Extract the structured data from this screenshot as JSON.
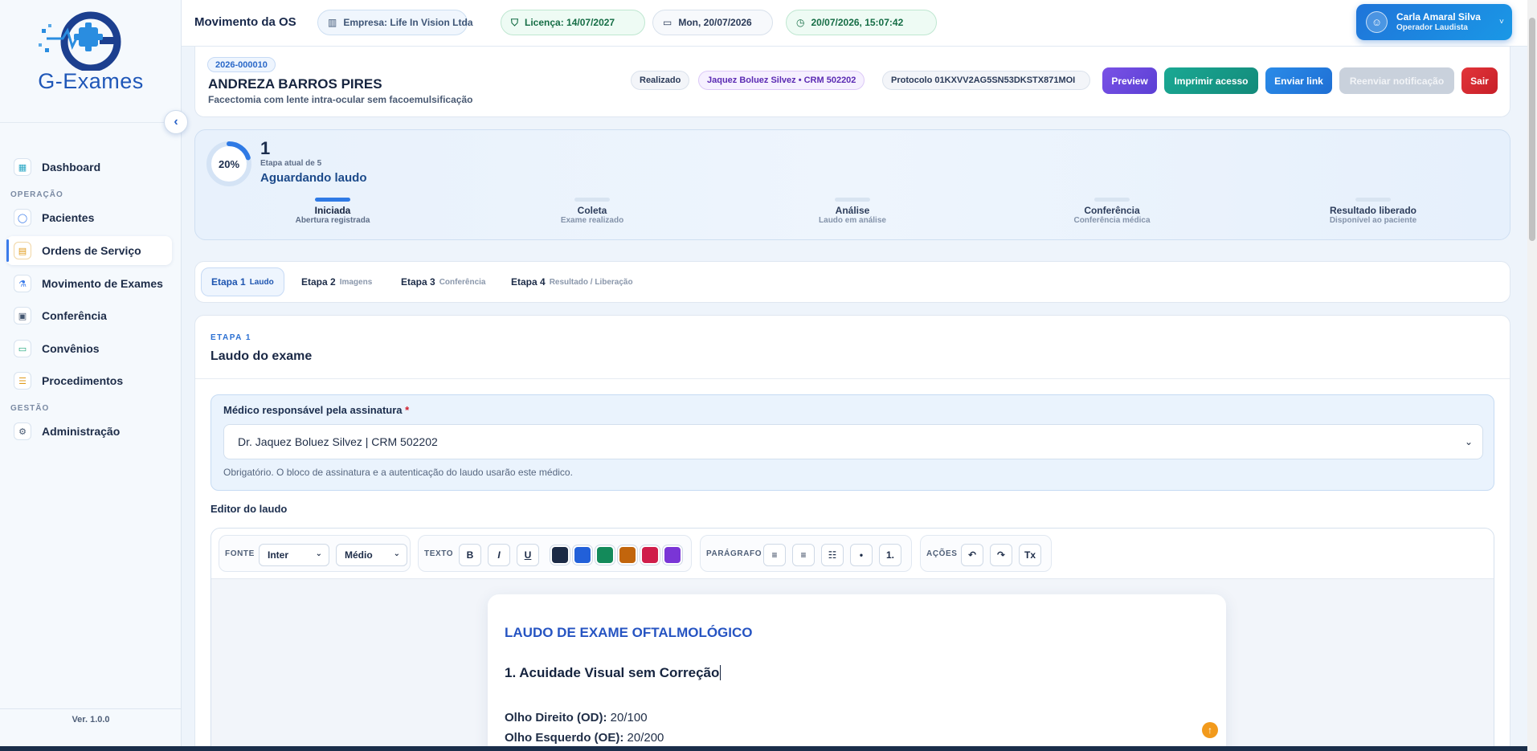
{
  "brand": {
    "name_part1": "G",
    "name_dash": "-",
    "name_part2": "Exames",
    "version": "Ver. 1.0.0"
  },
  "sidebar": {
    "items": [
      {
        "label": "Dashboard",
        "icon": "grid-icon"
      },
      {
        "label": "Pacientes",
        "icon": "user-icon"
      },
      {
        "label": "Ordens de Serviço",
        "icon": "document-icon"
      },
      {
        "label": "Movimento de Exames",
        "icon": "flask-icon"
      },
      {
        "label": "Conferência",
        "icon": "checklist-icon"
      },
      {
        "label": "Convênios",
        "icon": "card-icon"
      },
      {
        "label": "Procedimentos",
        "icon": "list-icon"
      },
      {
        "label": "Administração",
        "icon": "gear-icon"
      }
    ],
    "sections": {
      "operacao": "OPERAÇÃO",
      "gestao": "GESTÃO"
    }
  },
  "topbar": {
    "title": "Movimento da OS",
    "empresa": "Empresa: Life In Vision Ltda",
    "licenca": "Licença: 14/07/2027",
    "date": "Mon, 20/07/2026",
    "datetime": "20/07/2026, 15:07:42",
    "user_name": "Carla Amaral Silva",
    "user_role": "Operador Laudista"
  },
  "order": {
    "number": "2026-000010",
    "patient": "ANDREZA BARROS PIRES",
    "procedure": "Facectomia com lente intra-ocular sem facoemulsificação",
    "status": "Realizado",
    "doctor": "Jaquez Boluez Silvez • CRM 502202",
    "protocol": "Protocolo 01KXVV2AG5SN53DKSTX871MOI",
    "buttons": {
      "preview": "Preview",
      "print": "Imprimir acesso",
      "send": "Enviar link",
      "resend": "Reenviar notificação",
      "exit": "Sair"
    }
  },
  "progress": {
    "percent_label": "20%",
    "percent": 20,
    "stage": "1",
    "stage_of": "Etapa atual de 5",
    "status": "Aguardando laudo",
    "steps": [
      {
        "label": "Iniciada",
        "sub": "Abertura registrada"
      },
      {
        "label": "Coleta",
        "sub": "Exame realizado"
      },
      {
        "label": "Análise",
        "sub": "Laudo em análise"
      },
      {
        "label": "Conferência",
        "sub": "Conferência médica"
      },
      {
        "label": "Resultado liberado",
        "sub": "Disponível ao paciente"
      }
    ]
  },
  "tabs": [
    {
      "label": "Etapa 1",
      "sub": "Laudo"
    },
    {
      "label": "Etapa 2",
      "sub": "Imagens"
    },
    {
      "label": "Etapa 3",
      "sub": "Conferência"
    },
    {
      "label": "Etapa 4",
      "sub": "Resultado / Liberação"
    }
  ],
  "main": {
    "tag": "ETAPA 1",
    "title": "Laudo do exame",
    "signature_label": "Médico responsável pela assinatura",
    "signature_required": "*",
    "signature_value": "Dr. Jaquez Boluez Silvez | CRM 502202",
    "signature_help": "Obrigatório. O bloco de assinatura e a autenticação do laudo usarão este médico.",
    "editor_label": "Editor do laudo"
  },
  "toolbar": {
    "font_label": "FONTE",
    "font_value": "Inter",
    "size_value": "Médio",
    "text_label": "TEXTO",
    "bold": "B",
    "italic": "I",
    "underline": "U",
    "colors": [
      "#1b2a45",
      "#2260d9",
      "#138a5a",
      "#c2650c",
      "#d01d4a",
      "#7a35d6"
    ],
    "paragraph_label": "PARÁGRAFO",
    "actions_label": "AÇÕES",
    "undo": "↶",
    "redo": "↷",
    "clear": "Tx"
  },
  "document": {
    "title": "LAUDO DE EXAME OFTALMOLÓGICO",
    "heading": "1. Acuidade Visual sem Correção",
    "od_label": "Olho Direito (OD):",
    "od_value": "20/100",
    "oe_label": "Olho Esquerdo (OE):",
    "oe_value": "20/200"
  }
}
